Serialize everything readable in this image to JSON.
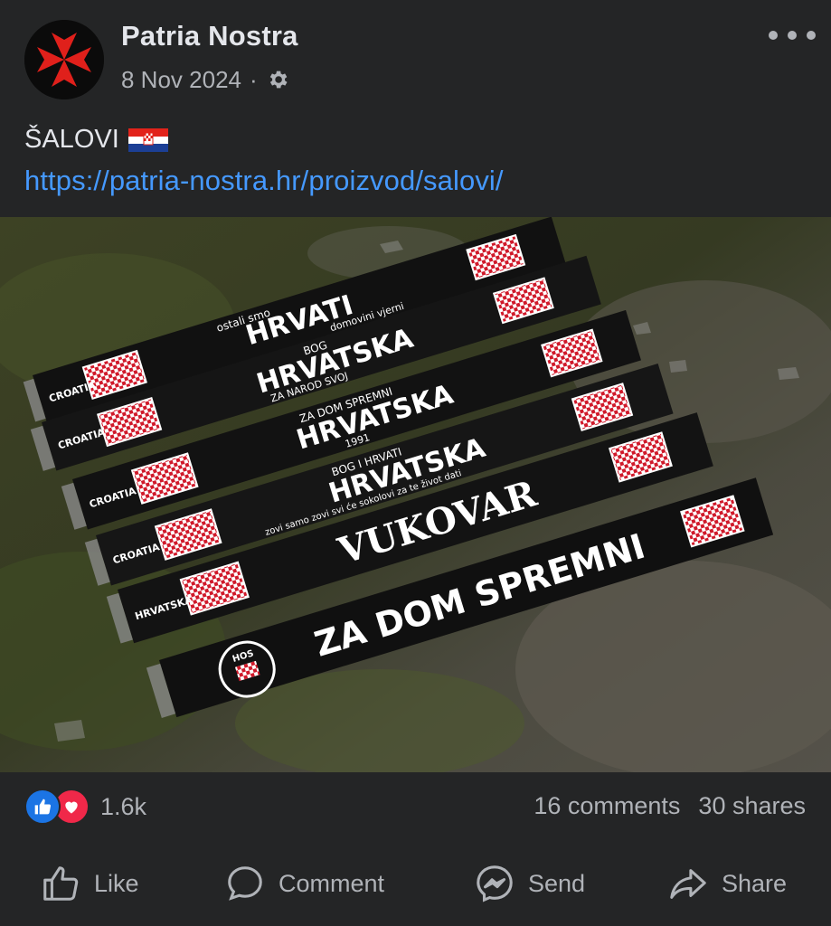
{
  "post": {
    "author": "Patria Nostra",
    "date": "8 Nov 2024",
    "separator": "·",
    "audience_icon": "gear-icon",
    "caption": "ŠALOVI",
    "caption_icon": "croatia-flag-icon",
    "link": "https://patria-nostra.hr/proizvod/salovi/"
  },
  "image": {
    "scarves": [
      {
        "top_text": "ostali smo",
        "main_text": "HRVATI",
        "bottom_text": "domovini vjerni",
        "end_text": "CROATIA"
      },
      {
        "top_text": "BOG",
        "main_text": "HRVATSKA",
        "bottom_text": "ZA NAROD SVOJ",
        "end_text": "CROATIA"
      },
      {
        "top_text": "ZA DOM SPREMNI",
        "main_text": "HRVATSKA",
        "bottom_text": "1991",
        "end_text": "CROATIA"
      },
      {
        "top_text": "BOG I HRVATI",
        "main_text": "HRVATSKA",
        "bottom_text": "zovi samo zovi svi će sokolovi za te život dati",
        "end_text": "CROATIA"
      },
      {
        "top_text": "",
        "main_text": "VUKOVAR",
        "bottom_text": "",
        "end_text": "HRVATSKA"
      },
      {
        "top_text": "",
        "main_text": "ZA DOM SPREMNI",
        "bottom_text": "",
        "end_text": "HOS"
      }
    ]
  },
  "stats": {
    "reactions_count": "1.6k",
    "comments": "16 comments",
    "shares": "30 shares"
  },
  "actions": {
    "like": "Like",
    "comment": "Comment",
    "send": "Send",
    "share": "Share"
  },
  "colors": {
    "background": "#242526",
    "text_primary": "#e4e6eb",
    "text_secondary": "#b0b3b8",
    "link": "#4599ff",
    "like_blue": "#1b74e4",
    "love_red": "#f02849",
    "logo_red": "#e0201b"
  }
}
